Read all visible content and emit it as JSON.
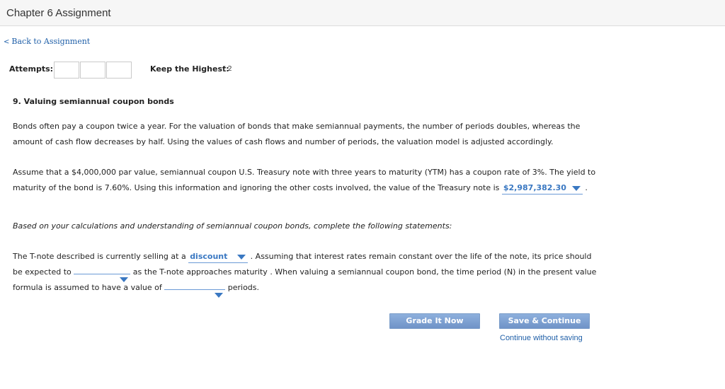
{
  "header": {
    "title": "Chapter 6 Assignment"
  },
  "nav": {
    "back_chevron": "<",
    "back_label": "Back to Assignment"
  },
  "attempts": {
    "label": "Attempts:",
    "box_count": 3
  },
  "keep": {
    "label": "Keep the Highest:",
    "value": "/ 2"
  },
  "question": {
    "title": "9. Valuing semiannual coupon bonds",
    "paragraph1": "Bonds often pay a coupon twice a year. For the valuation of bonds that make semiannual payments, the number of periods doubles, whereas the amount of cash flow decreases by half. Using the values of cash flows and number of periods, the valuation model is adjusted accordingly.",
    "paragraph2_before": "Assume that a $4,000,000 par value, semiannual coupon U.S. Treasury note with three years to maturity (YTM) has a coupon rate of 3%. The yield to maturity of the bond is 7.60%. Using this information and ignoring the other costs involved, the value of the Treasury note is ",
    "paragraph2_answer": "$2,987,382.30",
    "paragraph2_after": " .",
    "paragraph3": "Based on your calculations and understanding of semiannual coupon bonds, complete the following statements:",
    "p4_part1": "The T-note described is currently selling at a ",
    "p4_select1": "discount",
    "p4_part2": " . Assuming that interest rates remain constant over the life of the note, its price should be expected to ",
    "p4_select2": "",
    "p4_part3": " as the T-note approaches maturity . When valuing a semiannual coupon bond, the time period (N) in the present value formula is assumed to have a value of ",
    "p4_select3": "",
    "p4_part4": " periods."
  },
  "buttons": {
    "grade": "Grade It Now",
    "save": "Save & Continue",
    "continue_without": "Continue without saving"
  },
  "colors": {
    "link": "#1f5fa8",
    "accent": "#3a78c2",
    "button": "#7b9fd0"
  }
}
